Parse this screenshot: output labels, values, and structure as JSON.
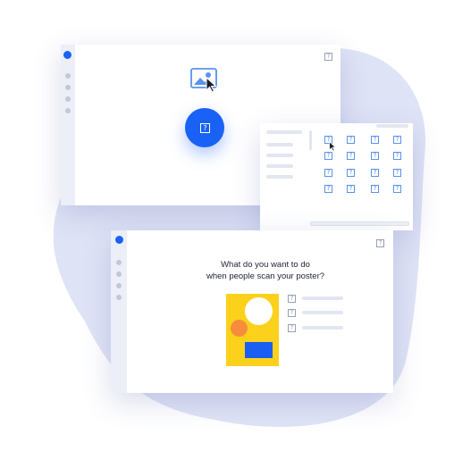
{
  "colors": {
    "accent": "#1a62f5",
    "icon_blue": "#5b92ee",
    "poster_yellow": "#fcd11c",
    "poster_orange": "#f58d3c",
    "rail_bg": "#eceef8",
    "blob": "#dfe3f6"
  },
  "icons": {
    "placeholder": "?",
    "image_icon": "image-icon",
    "cursor_icon": "cursor-icon"
  },
  "poster_window": {
    "question_line1": "What do you want to do",
    "question_line2": "when people scan your poster?"
  }
}
